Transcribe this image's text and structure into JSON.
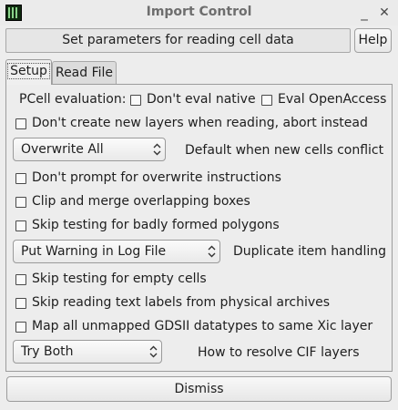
{
  "window": {
    "title": "Import Control",
    "icon": "cell-grid-icon",
    "minimize_glyph": "_",
    "close_glyph": "✕"
  },
  "header": {
    "label": "Set parameters for reading cell data",
    "help_label": "Help"
  },
  "tabs": [
    {
      "label": "Setup",
      "selected": true
    },
    {
      "label": "Read File",
      "selected": false
    }
  ],
  "pcell": {
    "label": "PCell evaluation:",
    "dont_eval_native": "Don't eval native",
    "eval_openaccess": "Eval OpenAccess"
  },
  "options": {
    "no_new_layers": "Don't create new layers when reading, abort instead",
    "no_prompt_overwrite": "Don't prompt for overwrite instructions",
    "clip_merge": "Clip and merge overlapping boxes",
    "skip_bad_polygons": "Skip testing for badly formed polygons",
    "skip_empty_cells": "Skip testing for empty cells",
    "skip_text_labels": "Skip reading text labels from physical archives",
    "map_gdsii": "Map all unmapped GDSII datatypes to same Xic layer"
  },
  "conflict": {
    "value": "Overwrite All",
    "label": "Default when new cells conflict"
  },
  "duplicate": {
    "value": "Put Warning in Log File",
    "label": "Duplicate item handling"
  },
  "cif": {
    "value": "Try Both",
    "label": "How to resolve CIF layers"
  },
  "footer": {
    "dismiss_label": "Dismiss"
  },
  "colors": {
    "background": "#ededed",
    "border": "#9c9c9c",
    "text": "#1e1e1e"
  }
}
